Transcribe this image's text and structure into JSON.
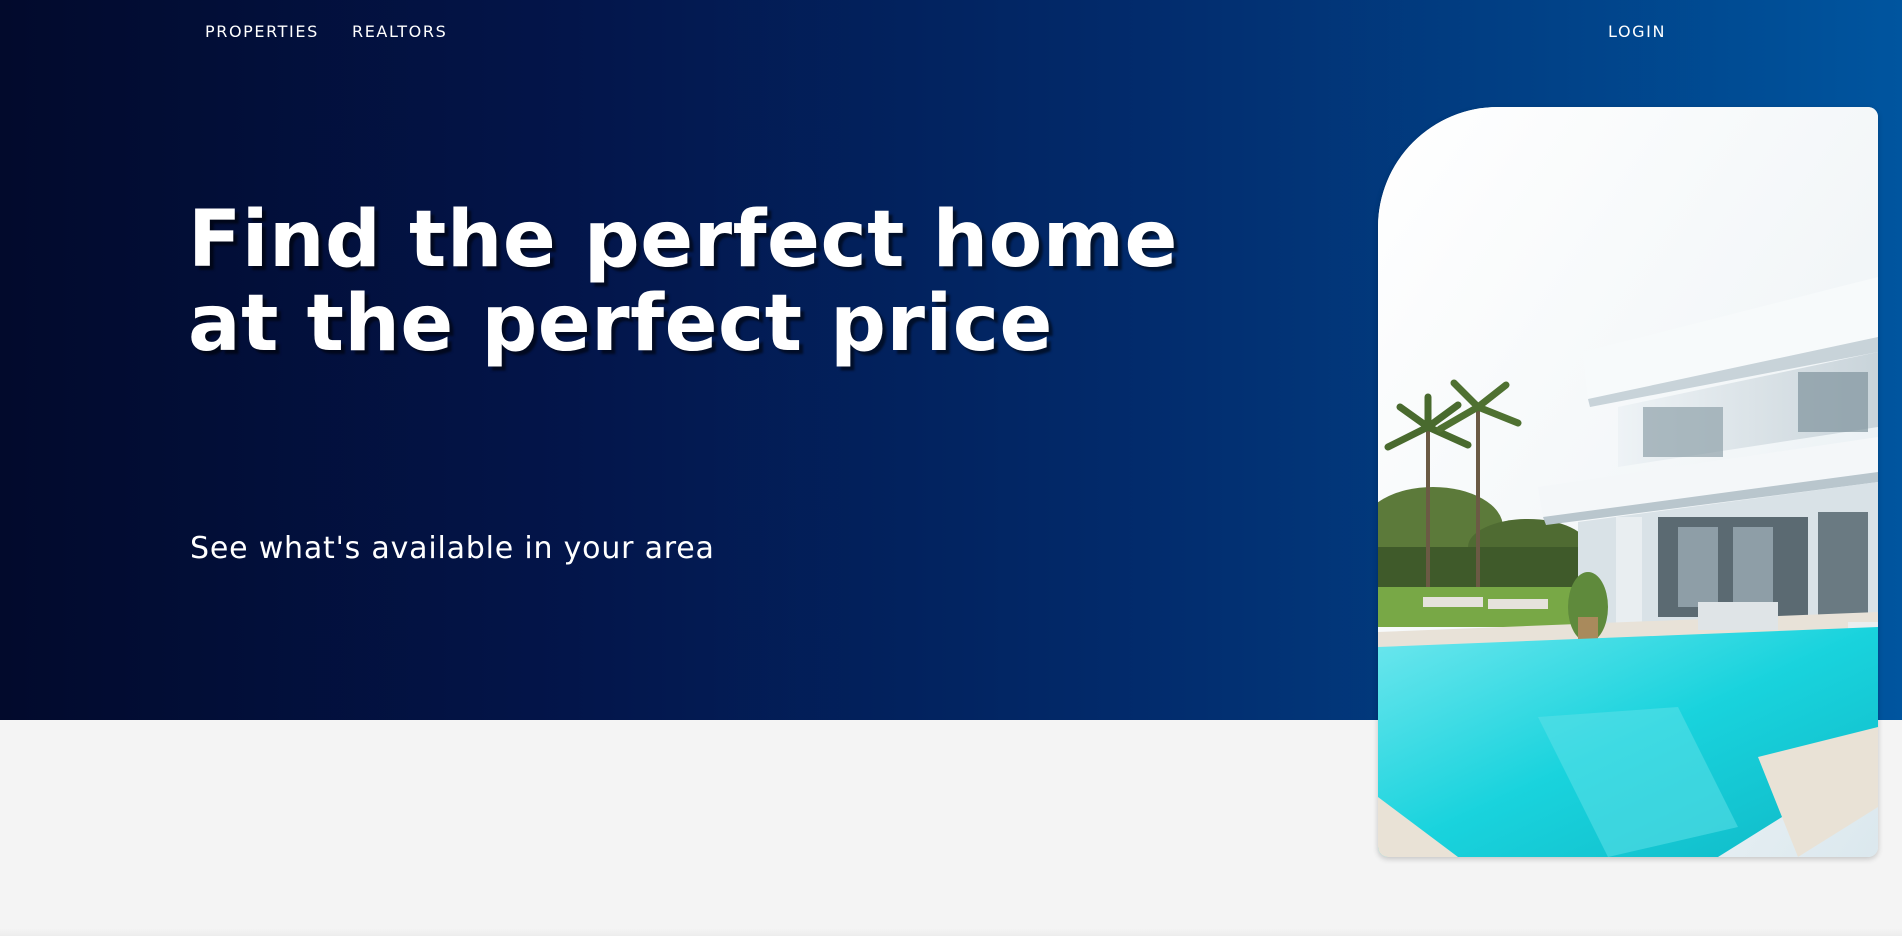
{
  "nav": {
    "properties_label": "PROPERTIES",
    "realtors_label": "REALTORS",
    "login_label": "LOGIN"
  },
  "hero": {
    "headline": "Find the perfect home at the perfect price",
    "subheadline": "See what's available in your area",
    "image_subject": "modern-villa-with-pool"
  },
  "colors": {
    "hero_gradient_start": "#020a2c",
    "hero_gradient_end": "#00559f",
    "page_background": "#f4f4f4",
    "text": "#ffffff"
  }
}
